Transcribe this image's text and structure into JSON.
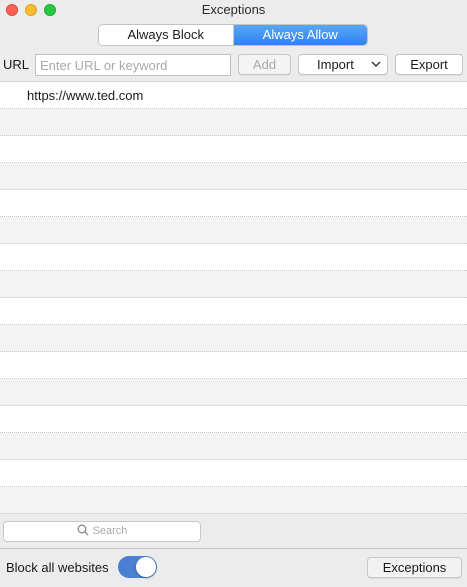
{
  "window": {
    "title": "Exceptions"
  },
  "tabs": [
    {
      "label": "Always Block",
      "selected": false
    },
    {
      "label": "Always Allow",
      "selected": true
    }
  ],
  "toolbar": {
    "url_label": "URL",
    "url_placeholder": "Enter URL or keyword",
    "url_value": "",
    "add_label": "Add",
    "import_label": "Import",
    "export_label": "Export"
  },
  "list": {
    "rows": [
      "https://www.ted.com",
      "",
      "",
      "",
      "",
      "",
      "",
      "",
      "",
      "",
      "",
      "",
      "",
      "",
      "",
      "",
      ""
    ]
  },
  "search": {
    "placeholder": "Search"
  },
  "footer": {
    "block_all_label": "Block all websites",
    "block_all_on": true,
    "exceptions_label": "Exceptions"
  },
  "colors": {
    "accent": "#2f83f2",
    "toggle_on": "#4b7fd1"
  }
}
